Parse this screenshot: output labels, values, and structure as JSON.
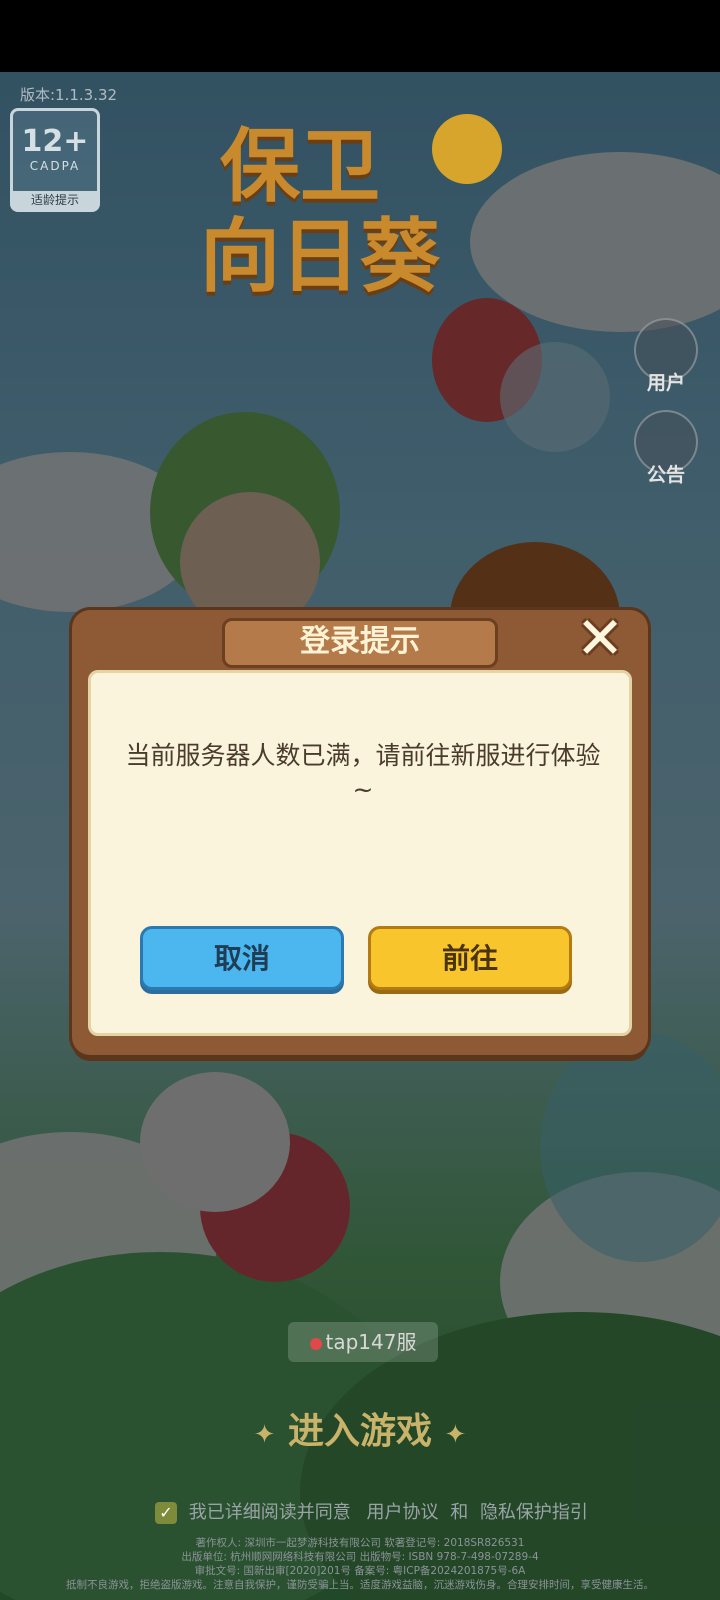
{
  "app": {
    "version": "版本:1.1.3.32",
    "age_rating": {
      "number": "12+",
      "org": "CADPA",
      "tip": "适龄提示"
    },
    "logo_line1": "保卫",
    "logo_line2": "向日葵"
  },
  "side_buttons": {
    "user_label": "用户",
    "notice_label": "公告"
  },
  "dialog": {
    "title": "登录提示",
    "message": "当前服务器人数已满，请前往新服进行体验~",
    "cancel_label": "取消",
    "go_label": "前往"
  },
  "server": {
    "name": "tap147服"
  },
  "enter_label": "进入游戏",
  "agreement": {
    "prefix": "我已详细阅读并同意",
    "user_agreement": "用户协议",
    "and": "和",
    "privacy": "隐私保护指引"
  },
  "footer": {
    "line1": "著作权人: 深圳市一起梦游科技有限公司  软著登记号: 2018SR826531",
    "line2": "出版单位: 杭州顺网网络科技有限公司  出版物号: ISBN 978-7-498-07289-4",
    "line3": "审批文号: 国新出审[2020]201号  备案号: 粤ICP备2024201875号-6A",
    "line4": "抵制不良游戏，拒绝盗版游戏。注意自我保护，谨防受骗上当。适度游戏益脑，沉迷游戏伤身。合理安排时间，享受健康生活。"
  },
  "colors": {
    "dialog_frame": "#8d5a35",
    "dialog_body": "#fbf4dc",
    "cancel_button": "#4bb7ee",
    "go_button": "#f8c52c"
  }
}
